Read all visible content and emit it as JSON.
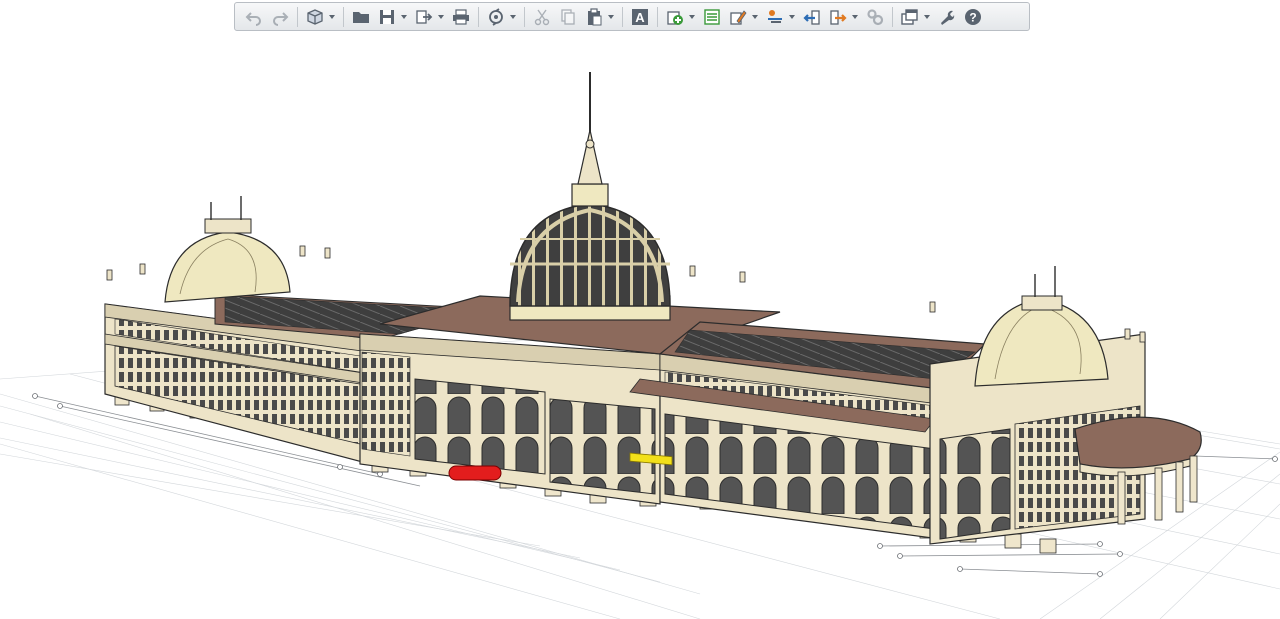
{
  "toolbar": {
    "groups": [
      [
        {
          "id": "undo",
          "icon": "undo-icon",
          "enabled": false,
          "dropdown": false
        },
        {
          "id": "redo",
          "icon": "redo-icon",
          "enabled": false,
          "dropdown": false
        }
      ],
      [
        {
          "id": "new-model",
          "icon": "cube-icon",
          "enabled": true,
          "dropdown": true
        }
      ],
      [
        {
          "id": "open",
          "icon": "folder-icon",
          "enabled": true,
          "dropdown": false
        },
        {
          "id": "save",
          "icon": "floppy-disk-icon",
          "enabled": true,
          "dropdown": true
        },
        {
          "id": "export",
          "icon": "export-icon",
          "enabled": true,
          "dropdown": true
        },
        {
          "id": "print",
          "icon": "printer-icon",
          "enabled": true,
          "dropdown": false
        }
      ],
      [
        {
          "id": "sync",
          "icon": "cloud-sync-icon",
          "enabled": true,
          "dropdown": true
        }
      ],
      [
        {
          "id": "cut",
          "icon": "scissors-icon",
          "enabled": false,
          "dropdown": false
        },
        {
          "id": "copy",
          "icon": "copy-icon",
          "enabled": false,
          "dropdown": false
        },
        {
          "id": "paste",
          "icon": "clipboard-icon",
          "enabled": true,
          "dropdown": true
        }
      ],
      [
        {
          "id": "text",
          "icon": "text-a-icon",
          "enabled": true,
          "dropdown": false
        }
      ],
      [
        {
          "id": "add-object",
          "icon": "add-plus-icon",
          "enabled": true,
          "dropdown": true
        },
        {
          "id": "list",
          "icon": "list-icon",
          "enabled": true,
          "dropdown": false
        },
        {
          "id": "edit-props",
          "icon": "edit-pencil-icon",
          "enabled": true,
          "dropdown": true
        },
        {
          "id": "filter",
          "icon": "filter-bulb-icon",
          "enabled": true,
          "dropdown": true
        },
        {
          "id": "import",
          "icon": "import-arrow-icon",
          "enabled": true,
          "dropdown": false
        },
        {
          "id": "export-data",
          "icon": "export-arrow-icon",
          "enabled": true,
          "dropdown": true
        },
        {
          "id": "settings-gears",
          "icon": "gears-icon",
          "enabled": false,
          "dropdown": false
        }
      ],
      [
        {
          "id": "windows",
          "icon": "windows-icon",
          "enabled": true,
          "dropdown": true
        },
        {
          "id": "tools",
          "icon": "wrench-icon",
          "enabled": true,
          "dropdown": false
        },
        {
          "id": "help",
          "icon": "help-icon",
          "enabled": true,
          "dropdown": false
        }
      ]
    ],
    "colors": {
      "blue": "#2d6db5",
      "green": "#3a9a3a",
      "orange": "#e07a22",
      "gray": "#5a6470"
    }
  },
  "viewport": {
    "colors": {
      "wall": "#ede4c8",
      "wall_shade": "#d9cfb0",
      "roof": "#8c6a5c",
      "dome": "#efe8c0",
      "dome_dark": "#3c3c3c",
      "outline": "#2c2c2c",
      "grid": "#c9cdd2",
      "selection_red": "#e31d1d",
      "selection_yellow": "#f2e01a"
    }
  }
}
